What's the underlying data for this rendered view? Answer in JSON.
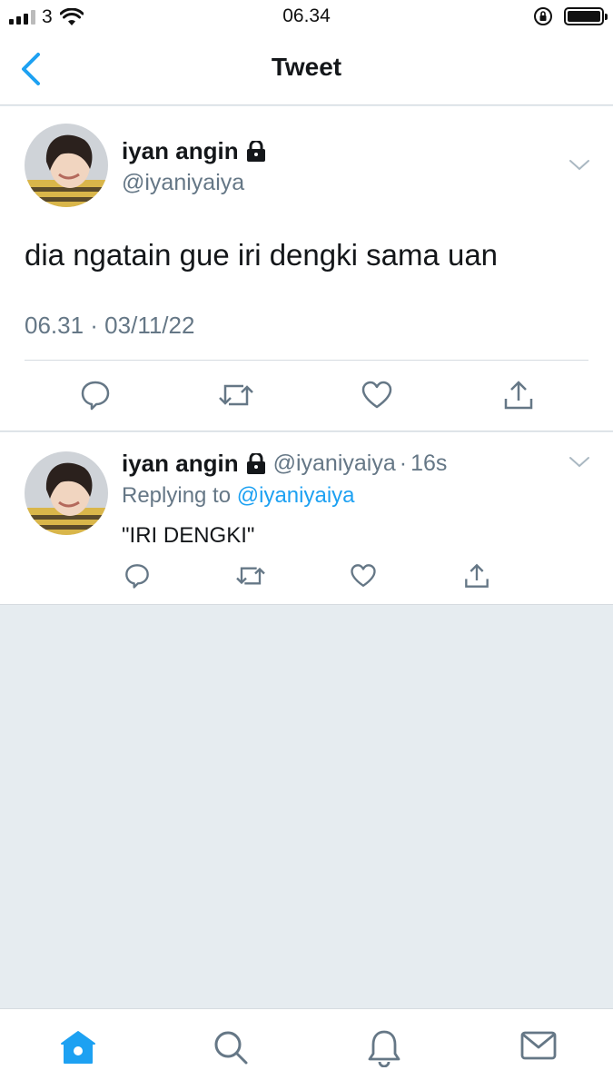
{
  "status_bar": {
    "carrier": "3",
    "time": "06.34",
    "icons": [
      "signal-icon",
      "wifi-icon",
      "orientation-lock-icon",
      "battery-icon"
    ]
  },
  "nav": {
    "title": "Tweet",
    "back_icon": "chevron-left-icon"
  },
  "main_tweet": {
    "display_name": "iyan angin",
    "handle": "@iyaniyaiya",
    "text": "dia ngatain gue iri dengki sama uan",
    "timestamp": "06.31 · 03/11/22",
    "actions": [
      "reply-icon",
      "retweet-icon",
      "like-icon",
      "share-icon"
    ]
  },
  "reply_tweet": {
    "display_name": "iyan angin",
    "handle": "@iyaniyaiya",
    "separator": "·",
    "age": "16s",
    "replying_prefix": "Replying to",
    "replying_to": "@iyaniyaiya",
    "text": "\"IRI DENGKI\"",
    "actions": [
      "reply-icon",
      "retweet-icon",
      "like-icon",
      "share-icon"
    ]
  },
  "tab_bar": {
    "tabs": [
      "home-icon",
      "search-icon",
      "notifications-icon",
      "messages-icon"
    ],
    "active": "home-icon"
  },
  "colors": {
    "accent": "#1da1f2",
    "secondary_text": "#657786",
    "background": "#e6ecf0",
    "divider": "#d6dbe0"
  }
}
